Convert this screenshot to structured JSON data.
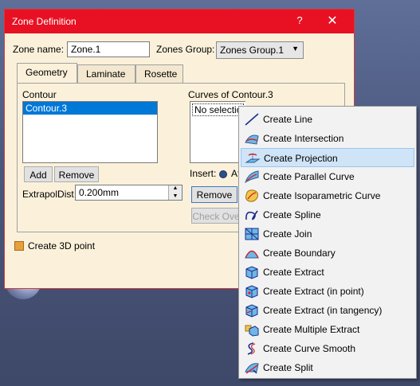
{
  "dialog": {
    "title": "Zone Definition",
    "help_label": "?",
    "close_label": "✕",
    "zone_name_label": "Zone name:",
    "zone_name_value": "Zone.1",
    "zones_group_label": "Zones Group:",
    "zones_group_value": "Zones Group.1",
    "tabs": [
      "Geometry",
      "Laminate",
      "Rosette"
    ],
    "contour_label": "Contour",
    "contour_items": [
      "Contour.3"
    ],
    "add_label": "Add",
    "remove_label": "Remove",
    "extrapol_label": "ExtrapolDist",
    "extrapol_value": "0.200mm",
    "curves_label": "Curves of Contour.3",
    "curves_items": [
      "No selection"
    ],
    "insert_label": "Insert:",
    "insert_after": "Af",
    "remove2_label": "Remove",
    "check_label": "Check Ove",
    "create3d_label": "Create 3D point"
  },
  "menu": {
    "items": [
      {
        "label": "Create Line",
        "icon": "line-icon"
      },
      {
        "label": "Create Intersection",
        "icon": "intersection-icon"
      },
      {
        "label": "Create Projection",
        "icon": "projection-icon",
        "highlighted": true
      },
      {
        "label": "Create Parallel Curve",
        "icon": "parallel-curve-icon"
      },
      {
        "label": "Create Isoparametric Curve",
        "icon": "isoparametric-curve-icon"
      },
      {
        "label": "Create Spline",
        "icon": "spline-icon"
      },
      {
        "label": "Create Join",
        "icon": "join-icon"
      },
      {
        "label": "Create Boundary",
        "icon": "boundary-icon"
      },
      {
        "label": "Create Extract",
        "icon": "extract-icon"
      },
      {
        "label": "Create Extract (in point)",
        "icon": "extract-in-point-icon"
      },
      {
        "label": "Create Extract (in tangency)",
        "icon": "extract-in-tangency-icon"
      },
      {
        "label": "Create Multiple Extract",
        "icon": "multiple-extract-icon"
      },
      {
        "label": "Create Curve Smooth",
        "icon": "curve-smooth-icon"
      },
      {
        "label": "Create Split",
        "icon": "split-icon"
      }
    ]
  },
  "colors": {
    "title_bar": "#e81123",
    "dialog_bg": "#fbf1da",
    "selection": "#0078d7",
    "menu_highlight": "#cfe4f7"
  }
}
